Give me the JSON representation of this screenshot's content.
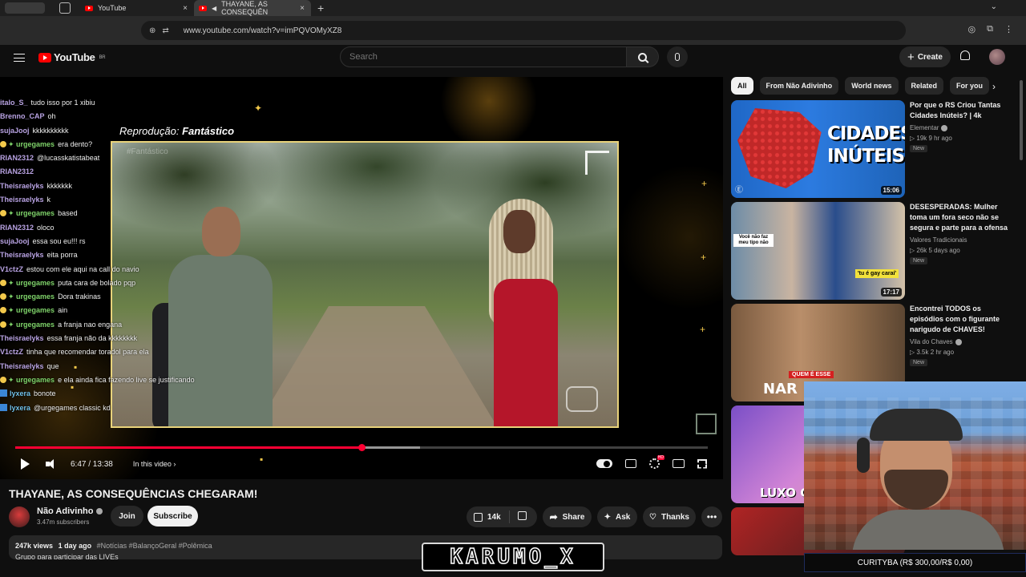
{
  "browser": {
    "tabs": [
      {
        "label": "YouTube"
      },
      {
        "label": "THAYANE, AS CONSEQUÊN"
      }
    ],
    "tab_close": "×",
    "new_tab": "+",
    "url": "www.youtube.com/watch?v=imPQVOMyXZ8"
  },
  "header": {
    "logo_text": "YouTube",
    "logo_region": "BR",
    "search_placeholder": "Search",
    "create_label": "Create",
    "create_plus": "+"
  },
  "chat": [
    {
      "user": "italo_S_",
      "msg": "tudo isso por 1 xibiu",
      "color": "purple",
      "badge": ""
    },
    {
      "user": "Brenno_CAP",
      "msg": "oh",
      "color": "purple",
      "badge": ""
    },
    {
      "user": "sujaJooj",
      "msg": "kkkkkkkkkk",
      "color": "purple",
      "badge": ""
    },
    {
      "user": "urgegames",
      "msg": "era dento?",
      "color": "green",
      "badge": "sub"
    },
    {
      "user": "RIAN2312",
      "msg": "@lucasskatistabeat",
      "color": "purple",
      "badge": ""
    },
    {
      "user": "RIAN2312",
      "msg": "",
      "color": "purple",
      "badge": ""
    },
    {
      "user": "Theisraelyks",
      "msg": "kkkkkkk",
      "color": "purple",
      "badge": ""
    },
    {
      "user": "Theisraelyks",
      "msg": "k",
      "color": "purple",
      "badge": ""
    },
    {
      "user": "urgegames",
      "msg": "based",
      "color": "green",
      "badge": "sub"
    },
    {
      "user": "RIAN2312",
      "msg": "oloco",
      "color": "purple",
      "badge": ""
    },
    {
      "user": "sujaJooj",
      "msg": "essa sou eu!!! rs",
      "color": "purple",
      "badge": ""
    },
    {
      "user": "Theisraelyks",
      "msg": "eita porra",
      "color": "purple",
      "badge": ""
    },
    {
      "user": "V1ctzZ",
      "msg": "estou com ele aqui na call do navio",
      "color": "purple",
      "badge": ""
    },
    {
      "user": "urgegames",
      "msg": "puta cara de bolado pqp",
      "color": "green",
      "badge": "sub"
    },
    {
      "user": "urgegames",
      "msg": "Dora trakinas",
      "color": "green",
      "badge": "sub"
    },
    {
      "user": "urgegames",
      "msg": "ain",
      "color": "green",
      "badge": "sub"
    },
    {
      "user": "urgegames",
      "msg": "a franja nao engana",
      "color": "green",
      "badge": "sub"
    },
    {
      "user": "Theisraelyks",
      "msg": "essa franja não da kkkkkkkk",
      "color": "purple",
      "badge": ""
    },
    {
      "user": "V1ctzZ",
      "msg": "tinha que recomendar toradol para ela",
      "color": "purple",
      "badge": ""
    },
    {
      "user": "Theisraelyks",
      "msg": "que",
      "color": "purple",
      "badge": ""
    },
    {
      "user": "urgegames",
      "msg": "e ela ainda fica fazendo live se justificando",
      "color": "green",
      "badge": "sub"
    },
    {
      "user": "lyxera",
      "msg": "bonote",
      "color": "cyan",
      "badge": "mod"
    },
    {
      "user": "lyxera",
      "msg": "@urgegames classic kd",
      "color": "cyan",
      "badge": "mod"
    }
  ],
  "player": {
    "overlay_caption_prefix": "Reprodução:",
    "overlay_caption_show": "Fantástico",
    "watermark": "#Fantástico",
    "progress_played": 0.5,
    "progress_buffered": 0.585,
    "time": "6:47 / 13:38",
    "chapter": "In this video",
    "chapter_chevron": "›"
  },
  "video": {
    "title": "THAYANE, AS CONSEQUÊNCIAS CHEGARAM!",
    "channel": "Não Adivinho",
    "subscribers": "3.47m subscribers",
    "join_label": "Join",
    "subscribe_label": "Subscribe",
    "likes": "14k",
    "share_label": "Share",
    "ask_label": "Ask",
    "thanks_label": "Thanks",
    "more": "•••",
    "views": "247k views",
    "age": "1 day ago",
    "tags": "#Notícias #BalançoGeral #Polêmica",
    "desc_line2": "Grupo para participar das LIVEs"
  },
  "chips": [
    "All",
    "From Não Adivinho",
    "World news",
    "Related",
    "For you"
  ],
  "chip_next": "›",
  "recommendations": [
    {
      "title": "Por que o RS Criou Tantas Cidades Inúteis? | 4k",
      "channel": "Elementar",
      "meta": "▷ 19k  9 hr ago",
      "badge": "New",
      "duration": "15:06",
      "thumb_text": "CIDADES INÚTEIS?"
    },
    {
      "title": "DESESPERADAS: Mulher toma um fora seco não se segura e parte para a ofensa",
      "channel": "Valores Tradicionais",
      "meta": "▷ 26k  5 days ago",
      "badge": "New",
      "duration": "17:17",
      "thumb_cap1": "Você não faz meu tipo não",
      "thumb_cap2": "'tu é gay caraí'"
    },
    {
      "title": "Encontrei TODOS os episódios com o figurante narigudo de CHAVES!",
      "channel": "Vila do Chaves",
      "meta": "▷ 3.5k  2 hr ago",
      "badge": "New",
      "thumb_cap": "QUEM É ESSE",
      "thumb_big": "NAR"
    },
    {
      "thumb_big": "LUXO C"
    }
  ],
  "overlay": {
    "ticker": "CURITYBA (R$ 300,00/R$ 0,00)",
    "streamer": "KARUMO_X"
  }
}
